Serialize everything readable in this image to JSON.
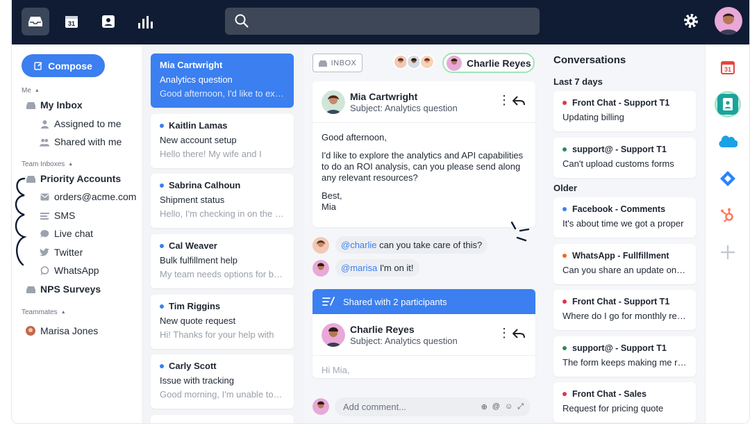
{
  "sidebar": {
    "compose_label": "Compose",
    "me_label": "Me",
    "my_inbox": "My Inbox",
    "assigned": "Assigned to me",
    "shared": "Shared with me",
    "team_label": "Team Inboxes",
    "priority": "Priority Accounts",
    "orders": "orders@acme.com",
    "sms": "SMS",
    "livechat": "Live chat",
    "twitter": "Twitter",
    "whatsapp": "WhatsApp",
    "nps": "NPS Surveys",
    "teammates_label": "Teammates",
    "marisa": "Marisa Jones"
  },
  "conversations": [
    {
      "name": "Mia Cartwright",
      "subject": "Analytics question",
      "preview": "Good afternoon, I'd like to explore the analytics"
    },
    {
      "name": "Kaitlin Lamas",
      "subject": "New account setup",
      "preview": "Hello there! My wife and I"
    },
    {
      "name": "Sabrina Calhoun",
      "subject": "Shipment status",
      "preview": "Hello, I'm checking in on the status"
    },
    {
      "name": "Cal Weaver",
      "subject": "Bulk fulfillment help",
      "preview": "My team needs options for bulk"
    },
    {
      "name": "Tim Riggins",
      "subject": "New quote request",
      "preview": "Hi! Thanks for your help with"
    },
    {
      "name": "Carly Scott",
      "subject": "Issue with tracking",
      "preview": "Good morning, I'm unable to track"
    }
  ],
  "pane": {
    "inbox_tag": "INBOX",
    "assignee": "Charlie Reyes",
    "message1": {
      "from": "Mia Cartwright",
      "subject_label": "Subject:",
      "subject": "Analytics question",
      "greeting": "Good afternoon,",
      "body": "I'd like to explore the analytics and API capabilities to do an ROI analysis, can you please send along any relevant resources?",
      "signoff": "Best,",
      "signature": "Mia"
    },
    "comment1": {
      "mention": "@charlie",
      "text": " can you take care of this?"
    },
    "comment2": {
      "mention": "@marisa",
      "text": " I'm on it!"
    },
    "shared_bar": "Shared with 2 participants",
    "message2": {
      "from": "Charlie Reyes",
      "subject_label": "Subject:",
      "subject": "Analytics question",
      "greeting": "Hi Mia,"
    },
    "comment_placeholder": "Add comment..."
  },
  "right": {
    "title": "Conversations",
    "group1": "Last 7 days",
    "group2": "Older",
    "items": [
      {
        "inbox": "Front Chat - Support T1",
        "snippet": "Updating billing",
        "color": "#e0354a"
      },
      {
        "inbox": "support@ - Support T1",
        "snippet": "Can't upload customs forms",
        "color": "#2e8b57"
      },
      {
        "inbox": "Facebook - Comments",
        "snippet": "It's about time we got a proper",
        "color": "#3b7ff0"
      },
      {
        "inbox": "WhatsApp - Fullfillment",
        "snippet": "Can you share an update on the",
        "color": "#f06a1d"
      },
      {
        "inbox": "Front Chat - Support T1",
        "snippet": "Where do I go for monthly reports",
        "color": "#e0354a"
      },
      {
        "inbox": "support@ - Support T1",
        "snippet": "The form keeps making me restart",
        "color": "#2e8b57"
      },
      {
        "inbox": "Front Chat - Sales",
        "snippet": "Request for pricing quote",
        "color": "#e0354a"
      }
    ]
  },
  "rail": {
    "calendar_day": "31"
  },
  "colors": {
    "accent": "#3b7ff0",
    "topbar": "#0f1c33"
  }
}
